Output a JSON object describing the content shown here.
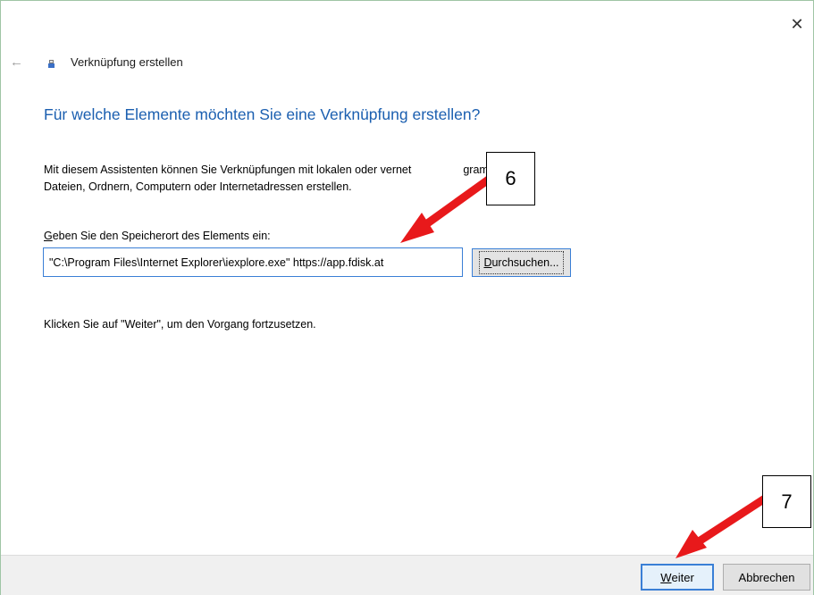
{
  "window": {
    "title": "Verknüpfung erstellen",
    "close_glyph": "✕",
    "back_glyph": "←"
  },
  "main": {
    "heading": "Für welche Elemente möchten Sie eine Verknüpfung erstellen?",
    "description_line1": "Mit diesem Assistenten können Sie Verknüpfungen mit lokalen oder vernet",
    "description_line1_end": "grammen,",
    "description_line2": "Dateien, Ordnern, Computern oder Internetadressen erstellen.",
    "field_label_access": "G",
    "field_label_rest": "eben Sie den Speicherort des Elements ein:",
    "location_value": "\"C:\\Program Files\\Internet Explorer\\iexplore.exe\" https://app.fdisk.at",
    "browse_access": "D",
    "browse_rest": "urchsuchen...",
    "continue_text": "Klicken Sie auf \"Weiter\", um den Vorgang fortzusetzen."
  },
  "footer": {
    "next_access": "W",
    "next_rest": "eiter",
    "cancel_label": "Abbrechen"
  },
  "annotations": {
    "step_6": "6",
    "step_7": "7",
    "arrow_color": "#e8191b"
  },
  "colors": {
    "heading": "#1b5fb0",
    "accent_border": "#3a7fd6"
  }
}
